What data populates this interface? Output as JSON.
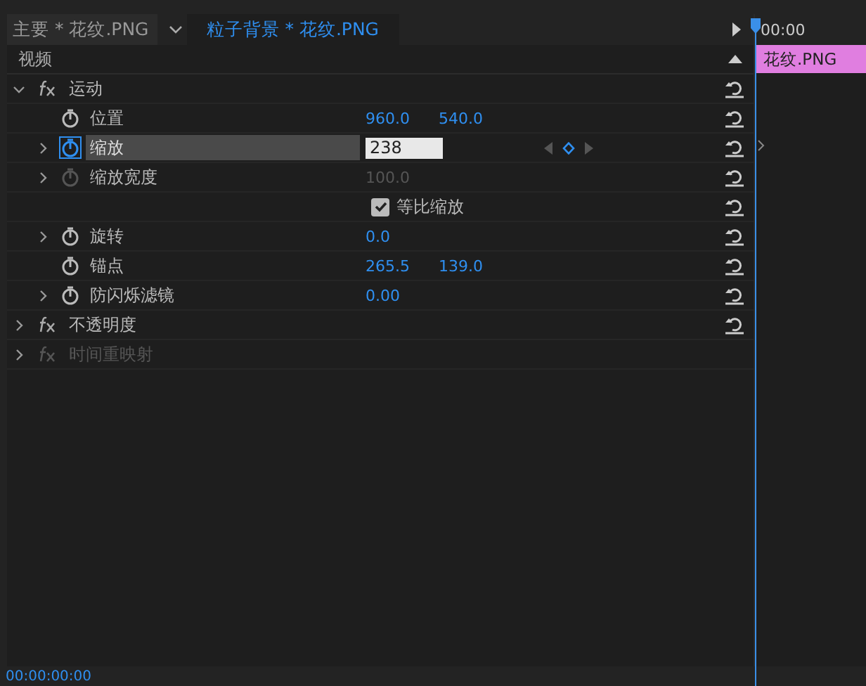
{
  "tabs": [
    {
      "label": "主要 * 花纹.PNG",
      "selected": false
    },
    {
      "label": "粒子背景 * 花纹.PNG",
      "selected": true
    }
  ],
  "section": {
    "label": "视频"
  },
  "timeline": {
    "timecode": "00:00",
    "clip": "花纹.PNG"
  },
  "rows": [
    {
      "kind": "effect",
      "label": "运动",
      "expanded": true,
      "disabled": false,
      "reset": true
    },
    {
      "kind": "property",
      "label": "位置",
      "expandable": false,
      "stopwatch_on": false,
      "disabled": false,
      "selected": false,
      "values": [
        "960.0",
        "540.0"
      ],
      "reset": true
    },
    {
      "kind": "property",
      "label": "缩放",
      "expandable": true,
      "stopwatch_on": true,
      "disabled": false,
      "selected": true,
      "input": "238",
      "keyframes": true,
      "reset": true
    },
    {
      "kind": "property",
      "label": "缩放宽度",
      "expandable": true,
      "stopwatch_on": false,
      "disabled": true,
      "selected": false,
      "values": [
        "100.0"
      ],
      "reset": true
    },
    {
      "kind": "checkbox",
      "label": "等比缩放",
      "checked": true,
      "reset": true
    },
    {
      "kind": "property",
      "label": "旋转",
      "expandable": true,
      "stopwatch_on": false,
      "disabled": false,
      "selected": false,
      "values": [
        "0.0"
      ],
      "reset": true
    },
    {
      "kind": "property",
      "label": "锚点",
      "expandable": false,
      "stopwatch_on": false,
      "disabled": false,
      "selected": false,
      "values": [
        "265.5",
        "139.0"
      ],
      "reset": true
    },
    {
      "kind": "property",
      "label": "防闪烁滤镜",
      "expandable": true,
      "stopwatch_on": false,
      "disabled": false,
      "selected": false,
      "values": [
        "0.00"
      ],
      "reset": true
    },
    {
      "kind": "effect",
      "label": "不透明度",
      "expanded": false,
      "disabled": false,
      "reset": true
    },
    {
      "kind": "effect",
      "label": "时间重映射",
      "expanded": false,
      "disabled": true,
      "reset": false
    }
  ],
  "status": {
    "timecode": "00:00:00:00"
  }
}
